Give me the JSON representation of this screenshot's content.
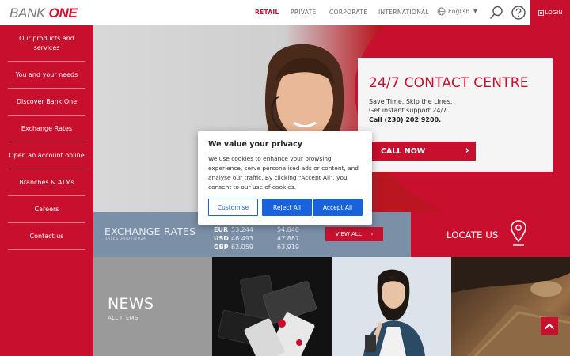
{
  "header": {
    "logo": {
      "bank": "BANK",
      "one": "ONE"
    },
    "nav": [
      "RETAIL",
      "PRIVATE",
      "CORPORATE",
      "INTERNATIONAL"
    ],
    "language": "English",
    "login": "LOGIN"
  },
  "sidebar": {
    "items": [
      {
        "label": "Our products and services"
      },
      {
        "label": "You and your needs"
      },
      {
        "label": "Discover Bank One"
      },
      {
        "label": "Exchange Rates"
      },
      {
        "label": "Open an account online"
      },
      {
        "label": "Branches & ATMs"
      },
      {
        "label": "Careers"
      },
      {
        "label": "Contact us"
      }
    ]
  },
  "hero": {
    "title": "24/7 CONTACT CENTRE",
    "line1": "Save Time, Skip the Lines.",
    "line2": "Get instant support 24/7.",
    "line3": "Call (230) 202 9200.",
    "cta": "CALL NOW"
  },
  "exchange": {
    "title": "EXCHANGE RATES",
    "subtitle": "RATES 30/07/2024",
    "rates": [
      {
        "cur": "EUR",
        "buy": "53.244",
        "sell": "54.840"
      },
      {
        "cur": "USD",
        "buy": "46.493",
        "sell": "47.887"
      },
      {
        "cur": "GBP",
        "buy": "62.059",
        "sell": "63.919"
      }
    ],
    "view_all": "VIEW ALL"
  },
  "locate": {
    "label": "LOCATE US"
  },
  "news": {
    "title": "NEWS",
    "subtitle": "ALL ITEMS"
  },
  "cookie": {
    "title": "We value your privacy",
    "text": "We use cookies to enhance your browsing experience, serve personalised ads or content, and analyse our traffic. By clicking \"Accept All\", you consent to our use of cookies.",
    "customise": "Customise",
    "reject": "Reject All",
    "accept": "Accept All"
  },
  "colors": {
    "brand_red": "#c8102e",
    "button_blue": "#1863dc",
    "exchange_band": "#7b8fa7"
  }
}
